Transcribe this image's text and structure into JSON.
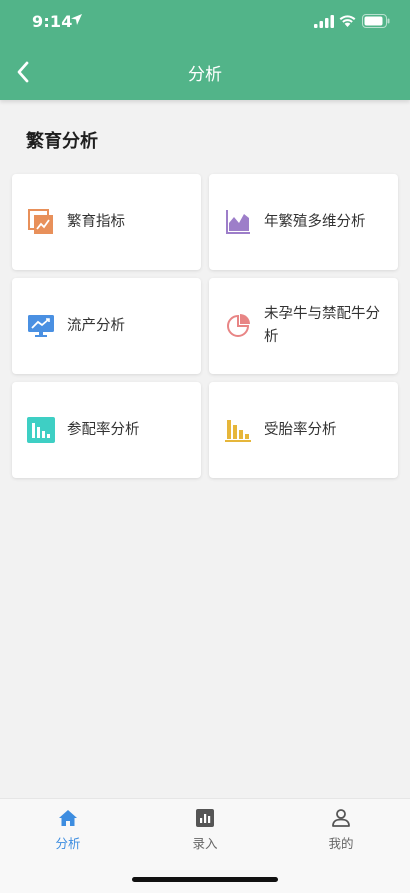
{
  "status_bar": {
    "time": "9:14"
  },
  "header": {
    "title": "分析"
  },
  "section": {
    "title": "繁育分析"
  },
  "cards": [
    {
      "label": "繁育指标",
      "icon": "breeding-index-icon",
      "color": "#e8905a"
    },
    {
      "label": "年繁殖多维分析",
      "icon": "area-chart-icon",
      "color": "#9d7ec9"
    },
    {
      "label": "流产分析",
      "icon": "monitor-trend-icon",
      "color": "#4a90e2"
    },
    {
      "label": "未孕牛与禁配牛分析",
      "icon": "pie-chart-icon",
      "color": "#e88585"
    },
    {
      "label": "参配率分析",
      "icon": "bar-chart-teal-icon",
      "color": "#3ecfc4"
    },
    {
      "label": "受胎率分析",
      "icon": "bar-chart-yellow-icon",
      "color": "#e6b63a"
    }
  ],
  "tabbar": {
    "items": [
      {
        "label": "分析",
        "icon": "home-icon",
        "active": true
      },
      {
        "label": "录入",
        "icon": "entry-chart-icon",
        "active": false
      },
      {
        "label": "我的",
        "icon": "profile-icon",
        "active": false
      }
    ]
  },
  "colors": {
    "header": "#52b489",
    "active_tab": "#3d8de0",
    "background": "#f2f2f2"
  }
}
